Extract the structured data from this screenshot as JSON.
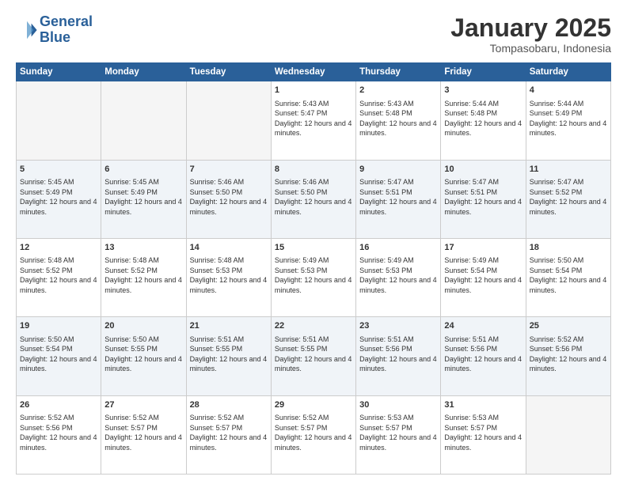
{
  "header": {
    "logo_line1": "General",
    "logo_line2": "Blue",
    "title": "January 2025",
    "location": "Tompasobaru, Indonesia"
  },
  "weekdays": [
    "Sunday",
    "Monday",
    "Tuesday",
    "Wednesday",
    "Thursday",
    "Friday",
    "Saturday"
  ],
  "weeks": [
    [
      {
        "day": "",
        "info": ""
      },
      {
        "day": "",
        "info": ""
      },
      {
        "day": "",
        "info": ""
      },
      {
        "day": "1",
        "info": "Sunrise: 5:43 AM\nSunset: 5:47 PM\nDaylight: 12 hours and 4 minutes."
      },
      {
        "day": "2",
        "info": "Sunrise: 5:43 AM\nSunset: 5:48 PM\nDaylight: 12 hours and 4 minutes."
      },
      {
        "day": "3",
        "info": "Sunrise: 5:44 AM\nSunset: 5:48 PM\nDaylight: 12 hours and 4 minutes."
      },
      {
        "day": "4",
        "info": "Sunrise: 5:44 AM\nSunset: 5:49 PM\nDaylight: 12 hours and 4 minutes."
      }
    ],
    [
      {
        "day": "5",
        "info": "Sunrise: 5:45 AM\nSunset: 5:49 PM\nDaylight: 12 hours and 4 minutes."
      },
      {
        "day": "6",
        "info": "Sunrise: 5:45 AM\nSunset: 5:49 PM\nDaylight: 12 hours and 4 minutes."
      },
      {
        "day": "7",
        "info": "Sunrise: 5:46 AM\nSunset: 5:50 PM\nDaylight: 12 hours and 4 minutes."
      },
      {
        "day": "8",
        "info": "Sunrise: 5:46 AM\nSunset: 5:50 PM\nDaylight: 12 hours and 4 minutes."
      },
      {
        "day": "9",
        "info": "Sunrise: 5:47 AM\nSunset: 5:51 PM\nDaylight: 12 hours and 4 minutes."
      },
      {
        "day": "10",
        "info": "Sunrise: 5:47 AM\nSunset: 5:51 PM\nDaylight: 12 hours and 4 minutes."
      },
      {
        "day": "11",
        "info": "Sunrise: 5:47 AM\nSunset: 5:52 PM\nDaylight: 12 hours and 4 minutes."
      }
    ],
    [
      {
        "day": "12",
        "info": "Sunrise: 5:48 AM\nSunset: 5:52 PM\nDaylight: 12 hours and 4 minutes."
      },
      {
        "day": "13",
        "info": "Sunrise: 5:48 AM\nSunset: 5:52 PM\nDaylight: 12 hours and 4 minutes."
      },
      {
        "day": "14",
        "info": "Sunrise: 5:48 AM\nSunset: 5:53 PM\nDaylight: 12 hours and 4 minutes."
      },
      {
        "day": "15",
        "info": "Sunrise: 5:49 AM\nSunset: 5:53 PM\nDaylight: 12 hours and 4 minutes."
      },
      {
        "day": "16",
        "info": "Sunrise: 5:49 AM\nSunset: 5:53 PM\nDaylight: 12 hours and 4 minutes."
      },
      {
        "day": "17",
        "info": "Sunrise: 5:49 AM\nSunset: 5:54 PM\nDaylight: 12 hours and 4 minutes."
      },
      {
        "day": "18",
        "info": "Sunrise: 5:50 AM\nSunset: 5:54 PM\nDaylight: 12 hours and 4 minutes."
      }
    ],
    [
      {
        "day": "19",
        "info": "Sunrise: 5:50 AM\nSunset: 5:54 PM\nDaylight: 12 hours and 4 minutes."
      },
      {
        "day": "20",
        "info": "Sunrise: 5:50 AM\nSunset: 5:55 PM\nDaylight: 12 hours and 4 minutes."
      },
      {
        "day": "21",
        "info": "Sunrise: 5:51 AM\nSunset: 5:55 PM\nDaylight: 12 hours and 4 minutes."
      },
      {
        "day": "22",
        "info": "Sunrise: 5:51 AM\nSunset: 5:55 PM\nDaylight: 12 hours and 4 minutes."
      },
      {
        "day": "23",
        "info": "Sunrise: 5:51 AM\nSunset: 5:56 PM\nDaylight: 12 hours and 4 minutes."
      },
      {
        "day": "24",
        "info": "Sunrise: 5:51 AM\nSunset: 5:56 PM\nDaylight: 12 hours and 4 minutes."
      },
      {
        "day": "25",
        "info": "Sunrise: 5:52 AM\nSunset: 5:56 PM\nDaylight: 12 hours and 4 minutes."
      }
    ],
    [
      {
        "day": "26",
        "info": "Sunrise: 5:52 AM\nSunset: 5:56 PM\nDaylight: 12 hours and 4 minutes."
      },
      {
        "day": "27",
        "info": "Sunrise: 5:52 AM\nSunset: 5:57 PM\nDaylight: 12 hours and 4 minutes."
      },
      {
        "day": "28",
        "info": "Sunrise: 5:52 AM\nSunset: 5:57 PM\nDaylight: 12 hours and 4 minutes."
      },
      {
        "day": "29",
        "info": "Sunrise: 5:52 AM\nSunset: 5:57 PM\nDaylight: 12 hours and 4 minutes."
      },
      {
        "day": "30",
        "info": "Sunrise: 5:53 AM\nSunset: 5:57 PM\nDaylight: 12 hours and 4 minutes."
      },
      {
        "day": "31",
        "info": "Sunrise: 5:53 AM\nSunset: 5:57 PM\nDaylight: 12 hours and 4 minutes."
      },
      {
        "day": "",
        "info": ""
      }
    ]
  ]
}
